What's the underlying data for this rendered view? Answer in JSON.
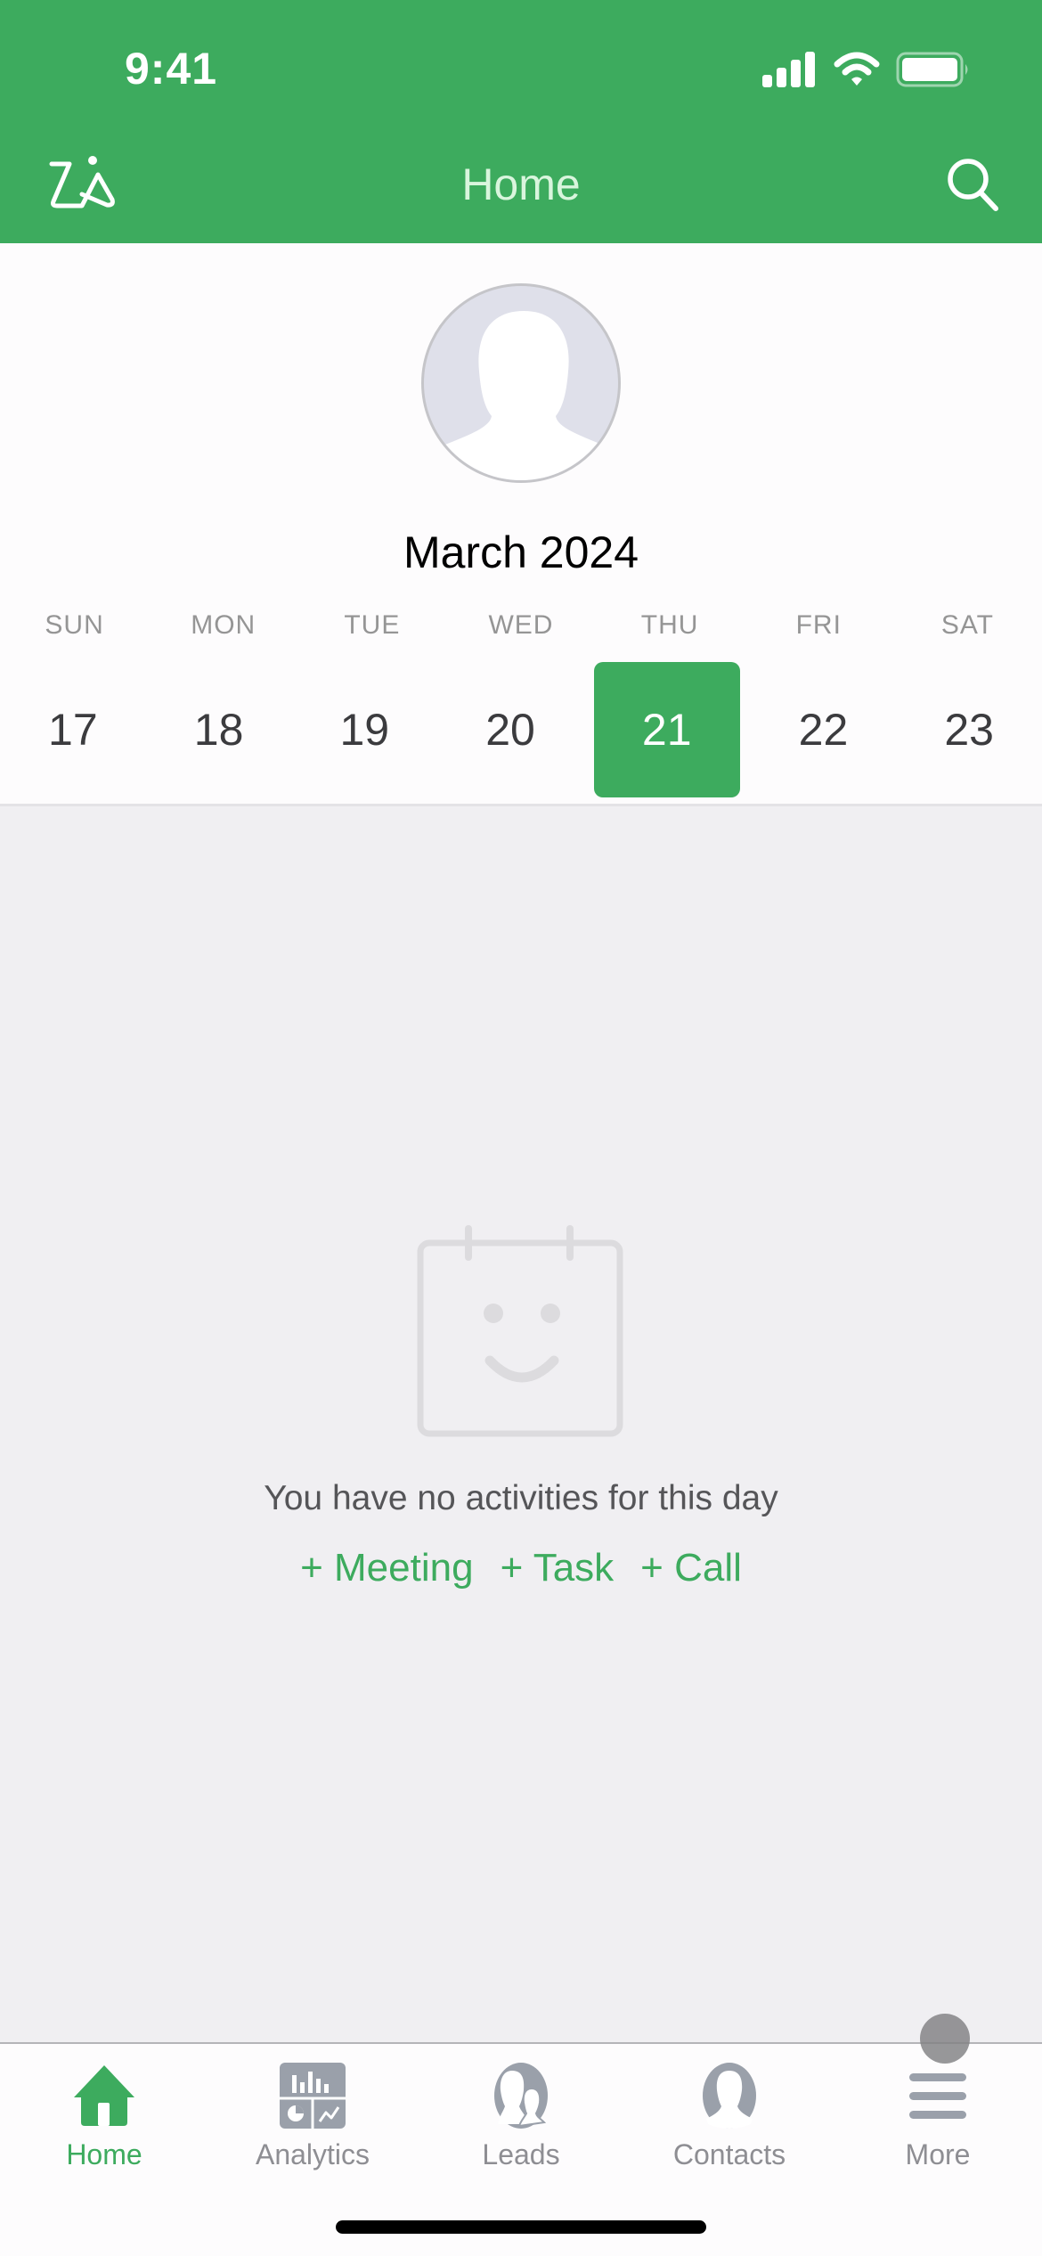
{
  "status_bar": {
    "time": "9:41",
    "icons": [
      "signal-icon",
      "wifi-icon",
      "battery-icon"
    ]
  },
  "nav": {
    "title": "Home",
    "left_icon": "zia-icon",
    "right_icon": "search-icon"
  },
  "profile": {
    "avatar": "default-avatar"
  },
  "calendar": {
    "month": "March 2024",
    "weekdays": [
      "SUN",
      "MON",
      "TUE",
      "WED",
      "THU",
      "FRI",
      "SAT"
    ],
    "days": [
      "17",
      "18",
      "19",
      "20",
      "21",
      "22",
      "23"
    ],
    "selected_day": "21"
  },
  "empty_state": {
    "icon": "calendar-smile-icon",
    "message": "You have no activities for this day",
    "actions": [
      "+ Meeting",
      "+ Task",
      "+ Call"
    ]
  },
  "tabbar": {
    "tabs": [
      {
        "label": "Home",
        "icon": "home-icon",
        "active": true
      },
      {
        "label": "Analytics",
        "icon": "analytics-icon",
        "active": false
      },
      {
        "label": "Leads",
        "icon": "leads-icon",
        "active": false
      },
      {
        "label": "Contacts",
        "icon": "contacts-icon",
        "active": false
      },
      {
        "label": "More",
        "icon": "menu-icon",
        "active": false
      }
    ]
  },
  "colors": {
    "brand": "#3dab5e",
    "inactive": "#9aa0aa",
    "background": "#f0eff2"
  }
}
